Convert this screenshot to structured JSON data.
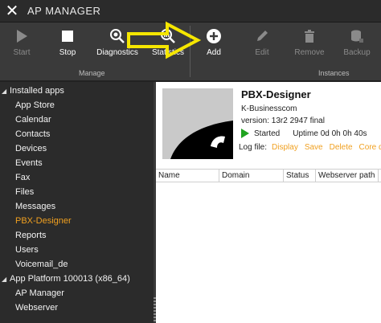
{
  "window": {
    "title": "AP MANAGER"
  },
  "toolbar": {
    "start": "Start",
    "stop": "Stop",
    "diagnostics": "Diagnostics",
    "statistics": "Statistics",
    "add": "Add",
    "edit": "Edit",
    "remove": "Remove",
    "backup": "Backup",
    "group_manage": "Manage",
    "group_instances": "Instances"
  },
  "sidebar": {
    "groups": [
      {
        "label": "Installed apps"
      },
      {
        "label": "App Platform 100013 (x86_64)"
      }
    ],
    "installed_items": [
      "App Store",
      "Calendar",
      "Contacts",
      "Devices",
      "Events",
      "Fax",
      "Files",
      "Messages",
      "PBX-Designer",
      "Reports",
      "Users",
      "Voicemail_de"
    ],
    "platform_items": [
      "AP Manager",
      "Webserver"
    ],
    "active": "PBX-Designer"
  },
  "app": {
    "name": "PBX-Designer",
    "vendor": "K-Businesscom",
    "version": "version: 13r2 2947 final",
    "status": "Started",
    "uptime": "Uptime 0d 0h 0h 40s"
  },
  "logfile": {
    "label": "Log file:",
    "display": "Display",
    "save": "Save",
    "delete": "Delete",
    "core": "Core du"
  },
  "table": {
    "columns": [
      "Name",
      "Domain",
      "Status",
      "Webserver path"
    ]
  },
  "colors": {
    "accent": "#f0a020",
    "running": "#1fa31f",
    "annotation_arrow": "#f5e600"
  }
}
